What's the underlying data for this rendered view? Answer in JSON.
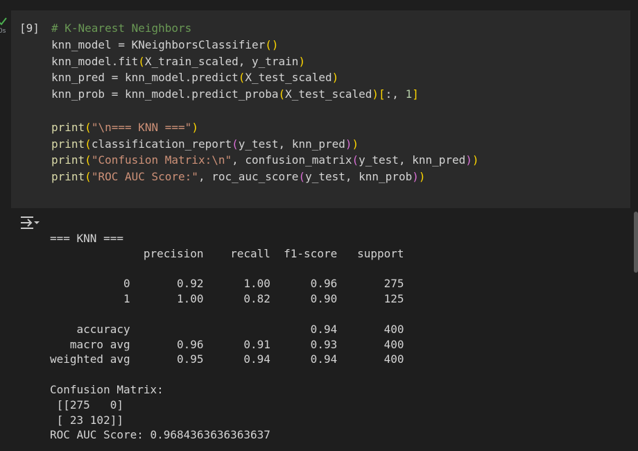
{
  "cell": {
    "execution_count": "[9]",
    "status_time": "0s",
    "code_lines": [
      [
        {
          "t": "# K-Nearest Neighbors",
          "c": "cm"
        }
      ],
      [
        {
          "t": "knn_model = "
        },
        {
          "t": "KNeighborsClassifier"
        },
        {
          "t": "()",
          "c": "p1"
        }
      ],
      [
        {
          "t": "knn_model.fit"
        },
        {
          "t": "(",
          "c": "p1"
        },
        {
          "t": "X_train_scaled, y_train"
        },
        {
          "t": ")",
          "c": "p1"
        }
      ],
      [
        {
          "t": "knn_pred = knn_model.predict"
        },
        {
          "t": "(",
          "c": "p1"
        },
        {
          "t": "X_test_scaled"
        },
        {
          "t": ")",
          "c": "p1"
        }
      ],
      [
        {
          "t": "knn_prob = knn_model.predict_proba"
        },
        {
          "t": "(",
          "c": "p1"
        },
        {
          "t": "X_test_scaled"
        },
        {
          "t": ")",
          "c": "p1"
        },
        {
          "t": "[",
          "c": "p1"
        },
        {
          "t": ":, "
        },
        {
          "t": "1",
          "c": "nm"
        },
        {
          "t": "]",
          "c": "p1"
        }
      ],
      [
        {
          "t": ""
        }
      ],
      [
        {
          "t": "print",
          "c": "fn"
        },
        {
          "t": "(",
          "c": "p1"
        },
        {
          "t": "\"\\n=== KNN ===\"",
          "c": "st"
        },
        {
          "t": ")",
          "c": "p1"
        }
      ],
      [
        {
          "t": "print",
          "c": "fn"
        },
        {
          "t": "(",
          "c": "p1"
        },
        {
          "t": "classification_report"
        },
        {
          "t": "(",
          "c": "p2"
        },
        {
          "t": "y_test, knn_pred"
        },
        {
          "t": ")",
          "c": "p2"
        },
        {
          "t": ")",
          "c": "p1"
        }
      ],
      [
        {
          "t": "print",
          "c": "fn"
        },
        {
          "t": "(",
          "c": "p1"
        },
        {
          "t": "\"Confusion Matrix:\\n\"",
          "c": "st"
        },
        {
          "t": ", confusion_matrix"
        },
        {
          "t": "(",
          "c": "p2"
        },
        {
          "t": "y_test, knn_pred"
        },
        {
          "t": ")",
          "c": "p2"
        },
        {
          "t": ")",
          "c": "p1"
        }
      ],
      [
        {
          "t": "print",
          "c": "fn"
        },
        {
          "t": "(",
          "c": "p1"
        },
        {
          "t": "\"ROC AUC Score:\"",
          "c": "st"
        },
        {
          "t": ", roc_auc_score"
        },
        {
          "t": "(",
          "c": "p2"
        },
        {
          "t": "y_test, knn_prob"
        },
        {
          "t": ")",
          "c": "p2"
        },
        {
          "t": ")",
          "c": "p1"
        }
      ]
    ]
  },
  "output": {
    "lines": [
      "=== KNN ===",
      "              precision    recall  f1-score   support",
      "",
      "           0       0.92      1.00      0.96       275",
      "           1       1.00      0.82      0.90       125",
      "",
      "    accuracy                           0.94       400",
      "   macro avg       0.96      0.91      0.93       400",
      "weighted avg       0.95      0.94      0.94       400",
      "",
      "Confusion Matrix:",
      " [[275   0]",
      " [ 23 102]]",
      "ROC AUC Score: 0.9684363636363637"
    ]
  },
  "colors": {
    "background": "#1e1e1e",
    "cell_background": "#2a2a2a",
    "comment": "#6a9955",
    "string": "#ce9178",
    "number": "#b5cea8",
    "function": "#dcdcaa",
    "bracket_level1": "#ffd700",
    "bracket_level2": "#da70d6",
    "check": "#4caf50"
  },
  "icons": {
    "status": "check-icon",
    "output_toggle": "output-toggle-icon"
  }
}
